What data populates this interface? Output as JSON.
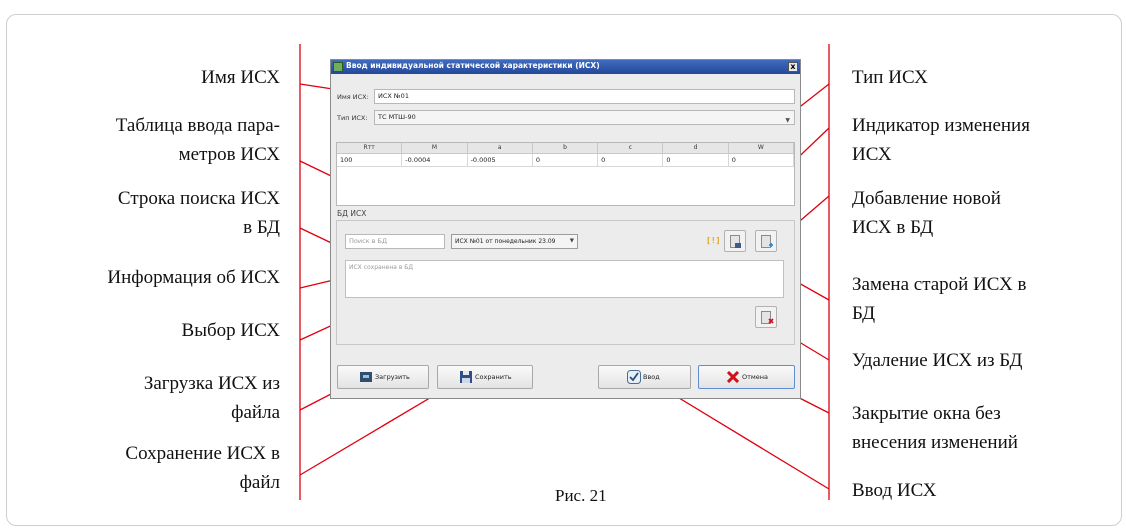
{
  "dialog": {
    "title": "Ввод индивидуальной статической характеристики (ИСХ)",
    "close_label": "x",
    "name_label": "Имя ИСХ:",
    "name_value": "ИСХ №01",
    "type_label": "Тип ИСХ:",
    "type_value": "ТС МТШ-90",
    "table": {
      "headers": [
        "Rтт",
        "M",
        "a",
        "b",
        "c",
        "d",
        "W"
      ],
      "rows": [
        [
          "100",
          "-0.0004",
          "-0.0005",
          "0",
          "0",
          "0",
          "0"
        ]
      ]
    },
    "db_section_label": "БД ИСХ",
    "search_placeholder": "Поиск в БД",
    "select_value": "ИСХ №01 от понедельник 23.09",
    "indicator": "[!]",
    "info_text": "ИСХ сохранена в БД",
    "buttons": {
      "load": "Загрузить",
      "save": "Сохранить",
      "enter": "Ввод",
      "cancel": "Отмена"
    },
    "icons": {
      "replace": "database-replace-icon",
      "add": "database-add-icon",
      "delete": "database-delete-icon"
    }
  },
  "callouts": {
    "left": [
      "Имя ИСХ",
      "Таблица ввода пара-",
      "метров ИСХ",
      "Строка поиска ИСХ",
      "в БД",
      "Информация об ИСХ",
      "Выбор ИСХ",
      "Загрузка ИСХ из",
      "файла",
      "Сохранение ИСХ в",
      "файл"
    ],
    "right": [
      "Тип ИСХ",
      "Индикатор изменения",
      "ИСХ",
      "Добавление новой",
      "ИСХ в БД",
      "Замена старой ИСХ в",
      "БД",
      "Удаление ИСХ из БД",
      "Закрытие окна без",
      "внесения изменений",
      "Ввод ИСХ"
    ]
  },
  "caption": "Рис. 21",
  "colors": {
    "leader_line": "#e0000f",
    "titlebar": "#2c54a8",
    "indicator": "#e8a000",
    "delete_mark": "#d0101a",
    "add_mark": "#2f8fd8"
  }
}
